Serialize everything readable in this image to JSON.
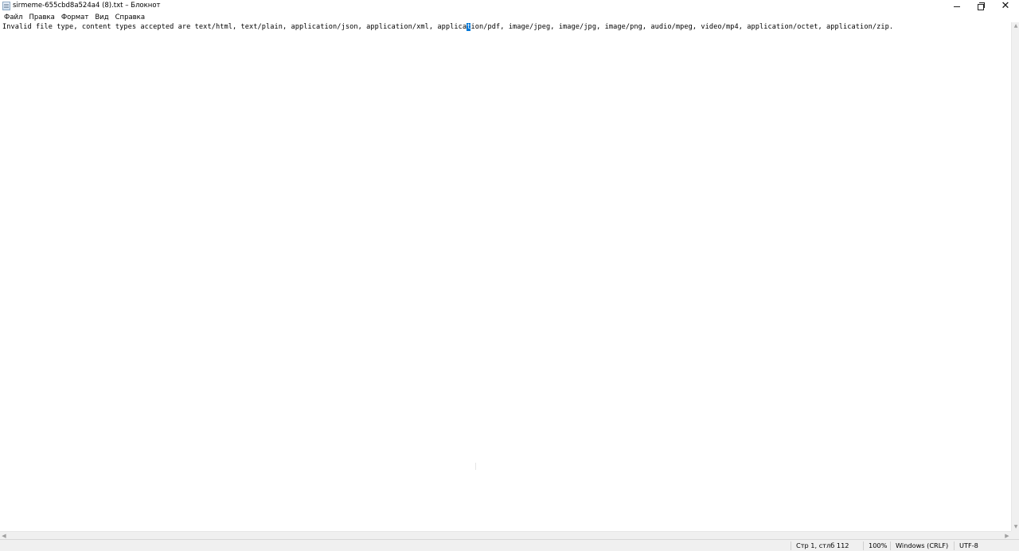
{
  "window": {
    "title": "sirmeme-655cbd8a524a4 (8).txt – Блокнот",
    "app_icon": "notepad-icon",
    "controls": {
      "minimize": "minimize-icon",
      "restore": "restore-icon",
      "close": "close-icon",
      "close_glyph": "✕"
    }
  },
  "menu": {
    "items": [
      {
        "label": "Файл"
      },
      {
        "label": "Правка"
      },
      {
        "label": "Формат"
      },
      {
        "label": "Вид"
      },
      {
        "label": "Справка"
      }
    ]
  },
  "editor": {
    "text_before": "Invalid file type, content types accepted are text/html, text/plain, application/json, application/xml, applica",
    "text_selected": "t",
    "text_after": "ion/pdf, image/jpeg, image/jpg, image/png, audio/mpeg, video/mp4, application/octet, application/zip."
  },
  "statusbar": {
    "position": "Стр 1, стлб 112",
    "zoom": "100%",
    "line_ending": "Windows (CRLF)",
    "encoding": "UTF-8"
  },
  "scrollbars": {
    "up_arrow": "▲",
    "down_arrow": "▼",
    "left_arrow": "◀",
    "right_arrow": "▶"
  }
}
